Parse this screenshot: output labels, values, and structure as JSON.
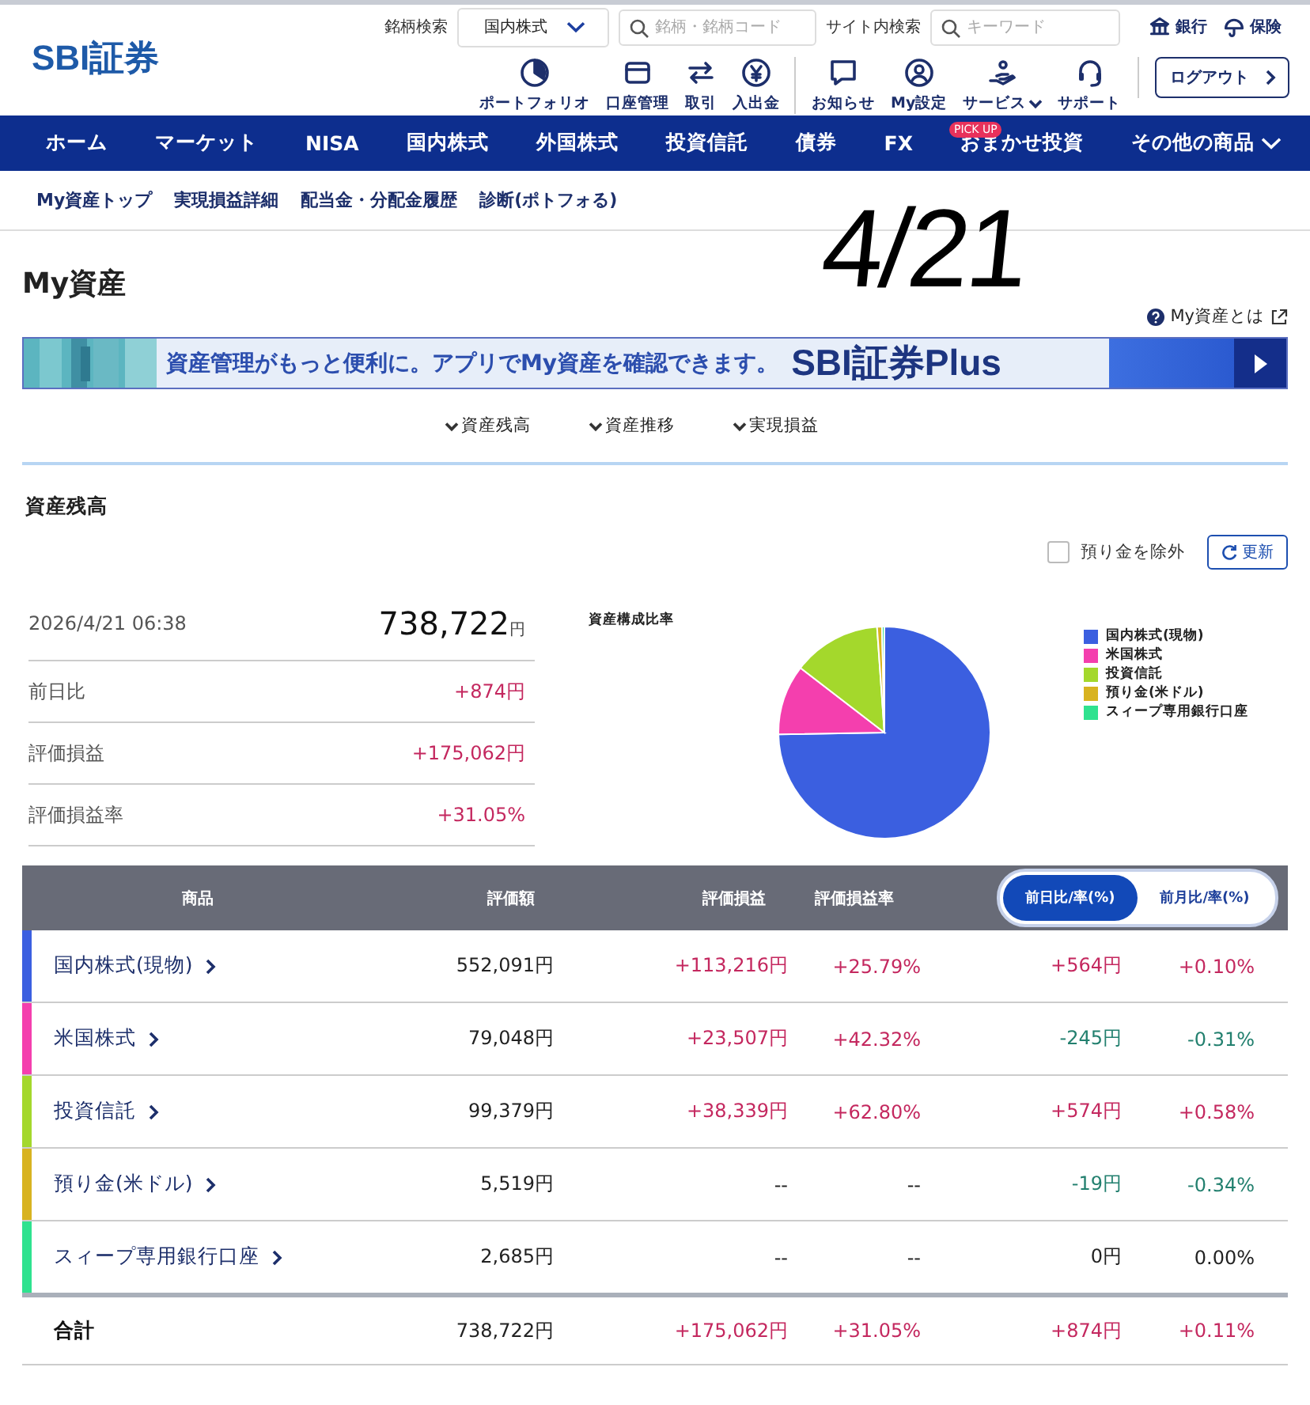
{
  "header": {
    "logo": "SBI証券",
    "stock_search_label": "銘柄検索",
    "market_select": "国内株式",
    "stock_search_placeholder": "銘柄・銘柄コード",
    "site_search_label": "サイト内検索",
    "site_search_placeholder": "キーワード",
    "top_links": [
      {
        "label": "銀行"
      },
      {
        "label": "保険"
      }
    ],
    "tools": [
      {
        "label": "ポートフォリオ"
      },
      {
        "label": "口座管理"
      },
      {
        "label": "取引"
      },
      {
        "label": "入出金"
      },
      {
        "label": "お知らせ"
      },
      {
        "label": "My設定"
      },
      {
        "label": "サービス",
        "dropdown": true
      },
      {
        "label": "サポート"
      }
    ],
    "logout": "ログアウト"
  },
  "nav": [
    {
      "label": "ホーム"
    },
    {
      "label": "マーケット"
    },
    {
      "label": "NISA"
    },
    {
      "label": "国内株式"
    },
    {
      "label": "外国株式"
    },
    {
      "label": "投資信託"
    },
    {
      "label": "債券"
    },
    {
      "label": "FX"
    },
    {
      "label": "おまかせ投資",
      "badge": "PICK UP"
    },
    {
      "label": "その他の商品",
      "dropdown": true
    }
  ],
  "subnav": [
    "My資産トップ",
    "実現損益詳細",
    "配当金・分配金履歴",
    "診断(ポトフォる)"
  ],
  "handwritten_note": "4/21",
  "page_title": "My資産",
  "help_link": "My資産とは",
  "banner": {
    "text": "資産管理がもっと便利に。アプリでMy資産を確認できます。",
    "brand": "SBI証券Plus"
  },
  "section_links": [
    "資産残高",
    "資産推移",
    "実現損益"
  ],
  "section_title": "資産残高",
  "exclude_deposit": {
    "label": "預り金を除外",
    "checked": false
  },
  "refresh_button": "更新",
  "summary": {
    "timestamp": "2026/4/21 06:38",
    "total": "738,722",
    "total_unit": "円",
    "rows": [
      {
        "label": "前日比",
        "value": "+874円",
        "color": "#c4285f"
      },
      {
        "label": "評価損益",
        "value": "+175,062円",
        "color": "#c4285f"
      },
      {
        "label": "評価損益率",
        "value": "+31.05%",
        "color": "#c4285f"
      }
    ]
  },
  "chart": {
    "title": "資産構成比率",
    "legend": [
      {
        "label": "国内株式(現物)",
        "color": "#3b5fe0"
      },
      {
        "label": "米国株式",
        "color": "#f43fae"
      },
      {
        "label": "投資信託",
        "color": "#a4d82c"
      },
      {
        "label": "預り金(米ドル)",
        "color": "#d8b320"
      },
      {
        "label": "スィープ専用銀行口座",
        "color": "#2fe28f"
      }
    ]
  },
  "table": {
    "columns": [
      "商品",
      "評価額",
      "評価損益",
      "評価損益率"
    ],
    "toggle": [
      {
        "label": "前日比/率(%)",
        "selected": true
      },
      {
        "label": "前月比/率(%)",
        "selected": false
      }
    ],
    "rows": [
      {
        "color": "#3b5fe0",
        "cells": [
          {
            "text": "国内株式(現物)"
          },
          {
            "text": "552,091円"
          },
          {
            "text": "+113,216円",
            "color": "#c4285f"
          },
          {
            "text": "+25.79%",
            "color": "#c4285f"
          },
          {
            "text": "+564円",
            "color": "#c4285f"
          },
          {
            "text": "+0.10%",
            "color": "#c4285f"
          }
        ]
      },
      {
        "color": "#f43fae",
        "cells": [
          {
            "text": "米国株式"
          },
          {
            "text": "79,048円"
          },
          {
            "text": "+23,507円",
            "color": "#c4285f"
          },
          {
            "text": "+42.32%",
            "color": "#c4285f"
          },
          {
            "text": "-245円",
            "color": "#23806f"
          },
          {
            "text": "-0.31%",
            "color": "#23806f"
          }
        ]
      },
      {
        "color": "#a4d82c",
        "cells": [
          {
            "text": "投資信託"
          },
          {
            "text": "99,379円"
          },
          {
            "text": "+38,339円",
            "color": "#c4285f"
          },
          {
            "text": "+62.80%",
            "color": "#c4285f"
          },
          {
            "text": "+574円",
            "color": "#c4285f"
          },
          {
            "text": "+0.58%",
            "color": "#c4285f"
          }
        ]
      },
      {
        "color": "#d8b320",
        "cells": [
          {
            "text": "預り金(米ドル)"
          },
          {
            "text": "5,519円"
          },
          {
            "text": "--"
          },
          {
            "text": "--"
          },
          {
            "text": "-19円",
            "color": "#23806f"
          },
          {
            "text": "-0.34%",
            "color": "#23806f"
          }
        ]
      },
      {
        "color": "#2fe28f",
        "cells": [
          {
            "text": "スィープ専用銀行口座"
          },
          {
            "text": "2,685円"
          },
          {
            "text": "--"
          },
          {
            "text": "--"
          },
          {
            "text": "0円"
          },
          {
            "text": "0.00%"
          }
        ]
      }
    ],
    "total": {
      "cells": [
        {
          "text": "合計"
        },
        {
          "text": "738,722円"
        },
        {
          "text": "+175,062円",
          "color": "#c4285f"
        },
        {
          "text": "+31.05%",
          "color": "#c4285f"
        },
        {
          "text": "+874円",
          "color": "#c4285f"
        },
        {
          "text": "+0.11%",
          "color": "#c4285f"
        }
      ]
    }
  }
}
